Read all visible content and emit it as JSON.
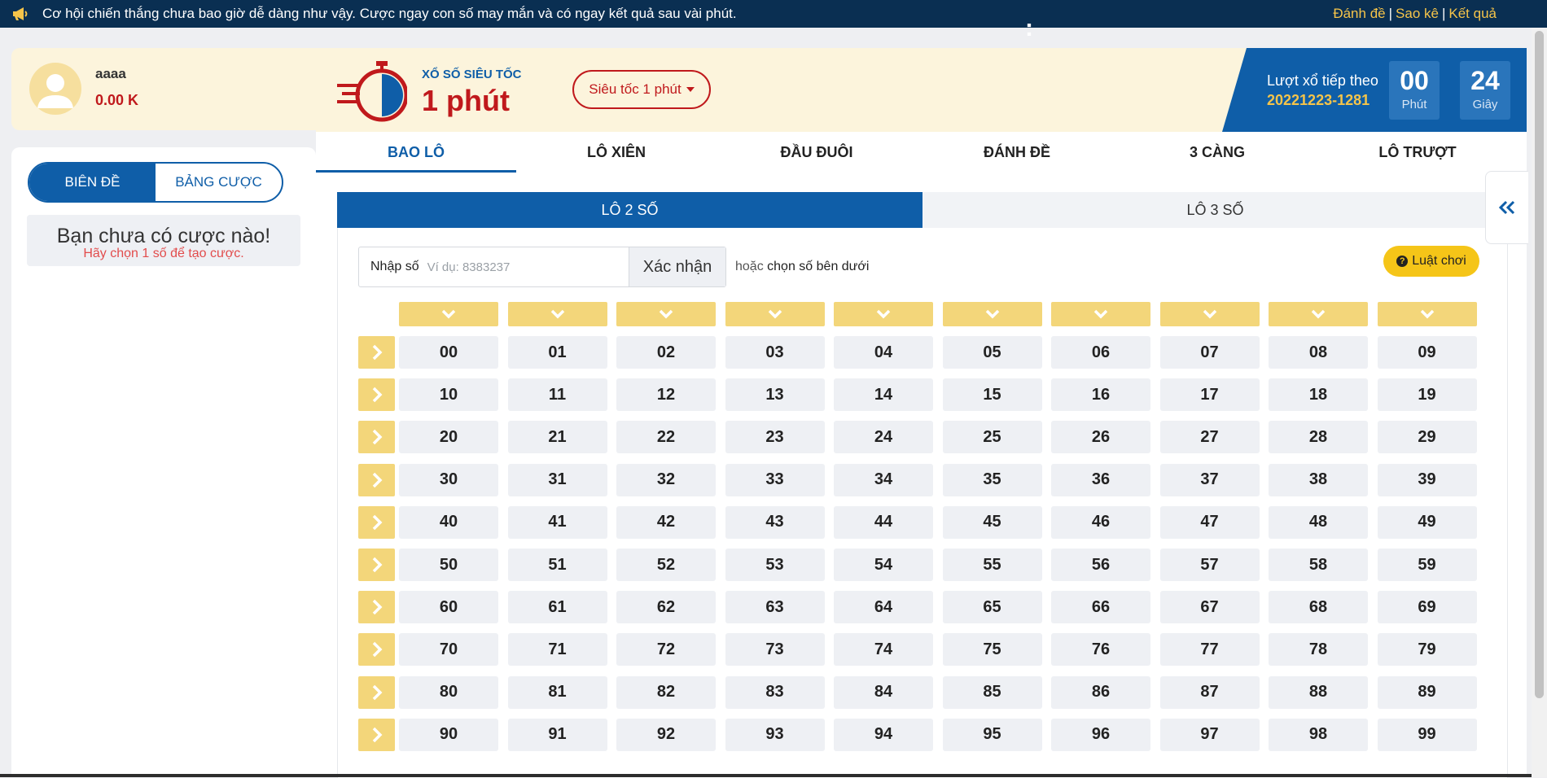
{
  "announcement": {
    "icon": "megaphone-icon",
    "text": "Cơ hội chiến thắng chưa bao giờ dễ dàng như vậy. Cược ngay con số may mắn và có ngay kết quả sau vài phút.",
    "links": [
      "Đánh đề",
      "Sao kê",
      "Kết quả"
    ]
  },
  "user": {
    "name": "aaaa",
    "balance": "0.00 K"
  },
  "left_panel": {
    "tabs": [
      "BIÊN ĐỀ",
      "BẢNG CƯỢC"
    ],
    "empty_title": "Bạn chưa có cược nào!",
    "empty_subtitle": "Hãy chọn 1 số để tạo cược."
  },
  "game": {
    "subtitle": "XỔ SỐ SIÊU TỐC",
    "title": "1 phút",
    "mode": "Siêu tốc 1 phút"
  },
  "countdown": {
    "label": "Lượt xổ tiếp theo",
    "draw_id": "20221223-1281",
    "minutes": "00",
    "minutes_label": "Phút",
    "seconds": "24",
    "seconds_label": "Giây",
    "separator": ":"
  },
  "tabs": [
    "BAO LÔ",
    "LÔ XIÊN",
    "ĐẦU ĐUÔI",
    "ĐÁNH ĐỀ",
    "3 CÀNG",
    "LÔ TRƯỢT"
  ],
  "subtabs": [
    "LÔ 2 SỐ",
    "LÔ 3 SỐ"
  ],
  "entry": {
    "label": "Nhập số",
    "placeholder": "Ví dụ: 8383237",
    "confirm": "Xác nhận",
    "or_prefix": "hoặc",
    "or_text": "chọn số bên dưới"
  },
  "rules_button": "Luật chơi",
  "colors": {
    "primary": "#0f5ea8",
    "accent": "#f5c44a",
    "danger": "#c0191c",
    "cream": "#fcf4dc"
  }
}
